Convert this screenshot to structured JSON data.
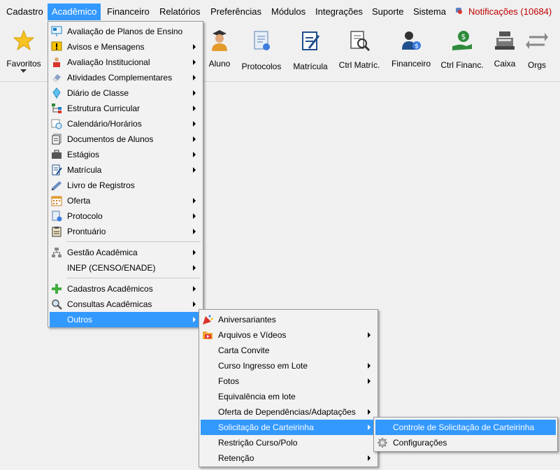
{
  "menubar": {
    "items": [
      "Cadastro",
      "Acadêmico",
      "Financeiro",
      "Relatórios",
      "Preferências",
      "Módulos",
      "Integrações",
      "Suporte",
      "Sistema"
    ],
    "notifications": "Notificações (10684)"
  },
  "toolbar": {
    "favoritos": "Favoritos",
    "aluno": "Aluno",
    "protocolos": "Protocolos",
    "matricula": "Matrícula",
    "ctrl_matric": "Ctrl Matríc.",
    "financeiro": "Financeiro",
    "ctrl_financ": "Ctrl Financ.",
    "caixa": "Caixa",
    "orgs": "Orgs"
  },
  "academico_menu": {
    "items": [
      "Avaliação de Planos de Ensino",
      "Avisos e Mensagens",
      "Avaliação Institucional",
      "Atividades Complementares",
      "Diário de Classe",
      "Estrutura Curricular",
      "Calendário/Horários",
      "Documentos de Alunos",
      "Estágios",
      "Matrícula",
      "Livro de Registros",
      "Oferta",
      "Protocolo",
      "Prontuário",
      "Gestão Acadêmica",
      "INEP (CENSO/ENADE)",
      "Cadastros Acadêmicos",
      "Consultas Acadêmicas",
      "Outros"
    ]
  },
  "outros_menu": {
    "items": [
      "Aniversariantes",
      "Arquivos e Vídeos",
      "Carta Convite",
      "Curso Ingresso em Lote",
      "Fotos",
      "Equivalência em lote",
      "Oferta de Dependências/Adaptações",
      "Solicitação de Carteirinha",
      "Restrição Curso/Polo",
      "Retenção"
    ]
  },
  "carteirinha_menu": {
    "items": [
      "Controle de Solicitação de Carteirinha",
      "Configurações"
    ]
  },
  "colors": {
    "highlight": "#3399ff",
    "notification": "#c00000"
  }
}
